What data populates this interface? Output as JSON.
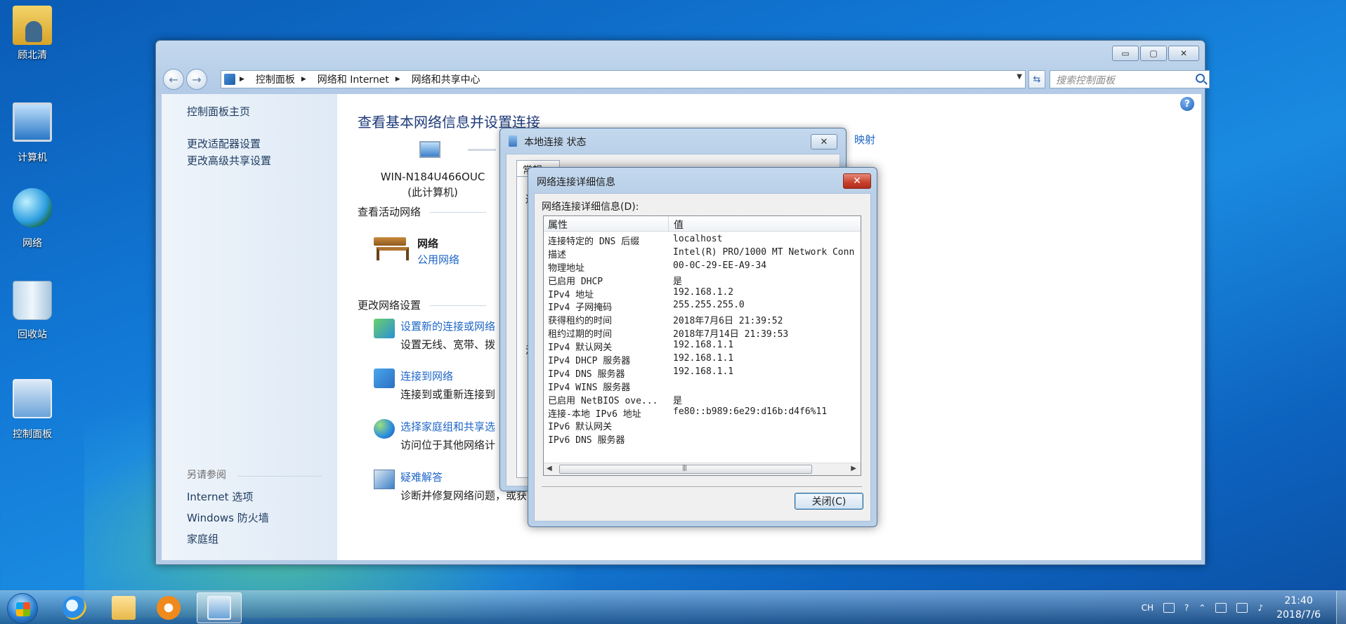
{
  "desktop": {
    "icons": [
      {
        "label": "顾北清",
        "icon": "user-folder-icon"
      },
      {
        "label": "计算机",
        "icon": "computer-icon"
      },
      {
        "label": "网络",
        "icon": "network-icon"
      },
      {
        "label": "回收站",
        "icon": "recycle-bin-icon"
      },
      {
        "label": "控制面板",
        "icon": "control-panel-icon"
      }
    ]
  },
  "window": {
    "controls": {
      "minimize": "▭",
      "maximize": "▢",
      "close": "✕"
    },
    "address": {
      "crumbs": [
        "控制面板",
        "网络和 Internet",
        "网络和共享中心"
      ],
      "search_placeholder": "搜索控制面板"
    },
    "left_pane": {
      "items": [
        "控制面板主页",
        "更改适配器设置",
        "更改高级共享设置"
      ],
      "see_also_title": "另请参阅",
      "see_also": [
        "Internet 选项",
        "Windows 防火墙",
        "家庭组"
      ]
    },
    "main": {
      "title": "查看基本网络信息并设置连接",
      "computer_name": "WIN-N184U466OUC",
      "computer_sub": "(此计算机)",
      "map_link": "映射",
      "active_networks_title": "查看活动网络",
      "network_name": "网络",
      "network_type": "公用网络",
      "change_settings_title": "更改网络设置",
      "tasks": [
        {
          "link": "设置新的连接或网络",
          "desc": "设置无线、宽带、拨"
        },
        {
          "link": "连接到网络",
          "desc": "连接到或重新连接到"
        },
        {
          "link": "选择家庭组和共享选",
          "desc": "访问位于其他网络计"
        },
        {
          "link": "疑难解答",
          "desc": "诊断并修复网络问题，或获"
        }
      ]
    }
  },
  "status_dialog": {
    "title": "本地连接 状态",
    "tab": "常规",
    "fragments": [
      "连",
      "活"
    ]
  },
  "details_dialog": {
    "title": "网络连接详细信息",
    "list_label": "网络连接详细信息(D):",
    "columns": {
      "property": "属性",
      "value": "值"
    },
    "rows": [
      {
        "prop": "连接特定的 DNS 后缀",
        "val": "localhost"
      },
      {
        "prop": "描述",
        "val": "Intel(R) PRO/1000 MT Network Conn"
      },
      {
        "prop": "物理地址",
        "val": "00-0C-29-EE-A9-34"
      },
      {
        "prop": "已启用 DHCP",
        "val": "是"
      },
      {
        "prop": "IPv4 地址",
        "val": "192.168.1.2"
      },
      {
        "prop": "IPv4 子网掩码",
        "val": "255.255.255.0"
      },
      {
        "prop": "获得租约的时间",
        "val": "2018年7月6日 21:39:52"
      },
      {
        "prop": "租约过期的时间",
        "val": "2018年7月14日 21:39:53"
      },
      {
        "prop": "IPv4 默认网关",
        "val": "192.168.1.1"
      },
      {
        "prop": "IPv4 DHCP 服务器",
        "val": "192.168.1.1"
      },
      {
        "prop": "IPv4 DNS 服务器",
        "val": "192.168.1.1"
      },
      {
        "prop": "IPv4 WINS 服务器",
        "val": ""
      },
      {
        "prop": "已启用 NetBIOS ove...",
        "val": "是"
      },
      {
        "prop": "连接-本地 IPv6 地址",
        "val": "fe80::b989:6e29:d16b:d4f6%11"
      },
      {
        "prop": "IPv6 默认网关",
        "val": ""
      },
      {
        "prop": "IPv6 DNS 服务器",
        "val": ""
      }
    ],
    "close_label": "关闭(C)"
  },
  "taskbar": {
    "tray": {
      "lang": "CH"
    },
    "clock": {
      "time": "21:40",
      "date": "2018/7/6"
    }
  }
}
